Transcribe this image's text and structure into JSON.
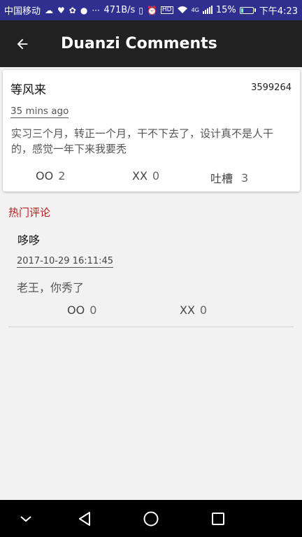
{
  "status_bar": {
    "carrier": "中国移动",
    "network_speed": "471B/s",
    "network_type": "4G",
    "battery_percent": "15%",
    "time": "下午4:23",
    "background_color": "#2f2f8f"
  },
  "app_bar": {
    "title": "Duanzi Comments",
    "back_icon": "arrow-left-icon",
    "background_color": "#212121"
  },
  "post": {
    "author": "等风来",
    "id": "3599264",
    "time": "35 mins ago",
    "content": "实习三个月，转正一个月，干不下去了，设计真不是人干的，感觉一年下来我要秃",
    "votes": [
      {
        "label": "OO",
        "count": "2"
      },
      {
        "label": "XX",
        "count": "0"
      },
      {
        "label": "吐槽",
        "count": "3"
      }
    ]
  },
  "hot_comments": {
    "section_label": "热门评论",
    "label_color": "#b71c1c",
    "items": [
      {
        "author": "哆哆",
        "time": "2017-10-29 16:11:45",
        "content": "老王，你秀了",
        "votes": [
          {
            "label": "OO",
            "count": "0"
          },
          {
            "label": "XX",
            "count": "0"
          }
        ]
      }
    ]
  },
  "nav_bar": {
    "buttons": [
      "collapse-icon",
      "back-triangle-icon",
      "home-circle-icon",
      "recents-square-icon"
    ]
  }
}
